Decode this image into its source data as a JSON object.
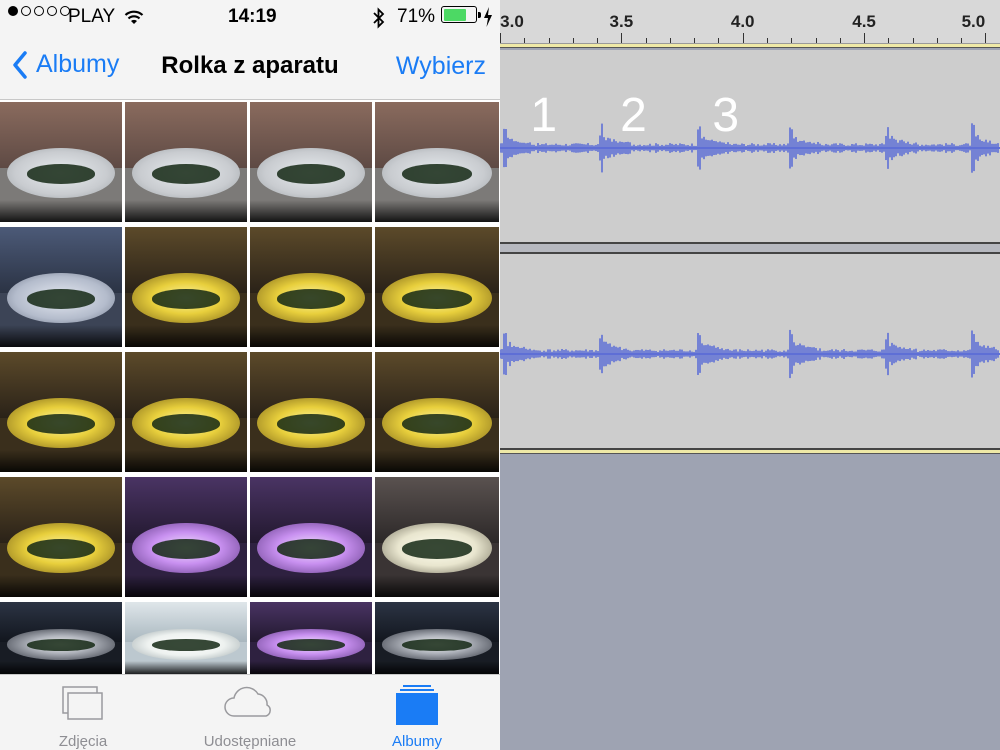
{
  "status_bar": {
    "signal_dots_filled": 1,
    "signal_dots_total": 5,
    "carrier": "PLAY",
    "wifi_icon": "wifi-icon",
    "time": "14:19",
    "bluetooth_icon": "bluetooth-icon",
    "battery_percent": "71%",
    "battery_level": 0.71,
    "charging_icon": "bolt-icon"
  },
  "nav": {
    "back_label": "Albumy",
    "title": "Rolka z aparatu",
    "select_label": "Wybierz",
    "accent_color": "#1a7cf5"
  },
  "photos": [
    {
      "tone": "day"
    },
    {
      "tone": "day"
    },
    {
      "tone": "day"
    },
    {
      "tone": "day"
    },
    {
      "tone": "blue"
    },
    {
      "tone": "yellow"
    },
    {
      "tone": "yellow"
    },
    {
      "tone": "yellow"
    },
    {
      "tone": "yellow"
    },
    {
      "tone": "yellow"
    },
    {
      "tone": "yellow"
    },
    {
      "tone": "yellow"
    },
    {
      "tone": "yellow"
    },
    {
      "tone": "purple"
    },
    {
      "tone": "purple"
    },
    {
      "tone": "white"
    },
    {
      "tone": "dark"
    },
    {
      "tone": "bright"
    },
    {
      "tone": "purple"
    },
    {
      "tone": "dark"
    }
  ],
  "tabs": [
    {
      "label": "Zdjęcia",
      "icon": "photos-icon",
      "active": false
    },
    {
      "label": "Udostępniane",
      "icon": "cloud-icon",
      "active": false
    },
    {
      "label": "Albumy",
      "icon": "albums-icon",
      "active": true
    }
  ],
  "editor": {
    "ruler_labels": [
      "3.0",
      "3.5",
      "4.0",
      "4.5",
      "5.0"
    ],
    "ruler_range": [
      3.0,
      5.06
    ],
    "markers": [
      {
        "label": "1",
        "time": 3.18
      },
      {
        "label": "2",
        "time": 3.55
      },
      {
        "label": "3",
        "time": 3.93
      }
    ],
    "waveform_color": "#5e6fd6",
    "beat_times": [
      3.02,
      3.42,
      3.82,
      4.2,
      4.6,
      4.95
    ]
  }
}
